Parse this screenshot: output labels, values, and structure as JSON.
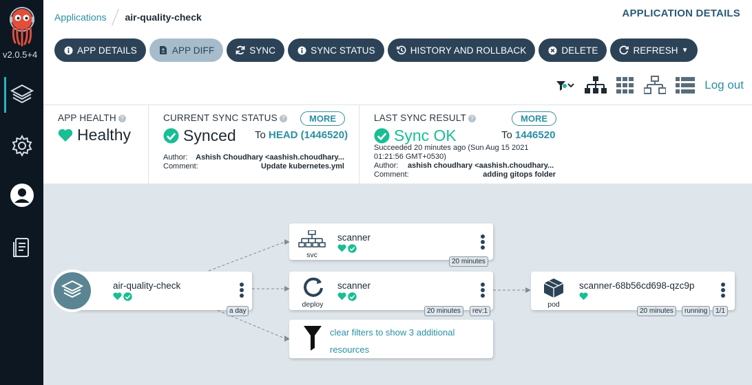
{
  "sidebar": {
    "version": "v2.0.5+4"
  },
  "header": {
    "breadcrumb_parent": "Applications",
    "breadcrumb_current": "air-quality-check",
    "page_title": "APPLICATION DETAILS"
  },
  "toolbar": {
    "buttons": [
      {
        "label": "APP DETAILS",
        "icon": "info-icon"
      },
      {
        "label": "APP DIFF",
        "icon": "file-diff-icon"
      },
      {
        "label": "SYNC",
        "icon": "sync-icon"
      },
      {
        "label": "SYNC STATUS",
        "icon": "info-icon"
      },
      {
        "label": "HISTORY AND ROLLBACK",
        "icon": "history-icon"
      },
      {
        "label": "DELETE",
        "icon": "times-circle-icon"
      },
      {
        "label": "REFRESH",
        "icon": "redo-icon"
      }
    ],
    "logout": "Log out"
  },
  "status": {
    "app_health": {
      "title": "APP HEALTH",
      "value": "Healthy"
    },
    "sync_status": {
      "title": "CURRENT SYNC STATUS",
      "more": "MORE",
      "value": "Synced",
      "to_prefix": "To",
      "to_value": "HEAD (1446520)",
      "author_label": "Author:",
      "author_value": "Ashish Choudhary <aashish.choudhary...",
      "comment_label": "Comment:",
      "comment_value": "Update kubernetes.yml"
    },
    "last_sync": {
      "title": "LAST SYNC RESULT",
      "more": "MORE",
      "value": "Sync OK",
      "to_prefix": "To",
      "to_value": "1446520",
      "succeeded_line1": "Succeeded 20 minutes ago (Sun Aug 15 2021",
      "succeeded_line2": "01:21:56 GMT+0530)",
      "author_label": "Author:",
      "author_value": "ashish choudhary <aashish.choudhary...",
      "comment_label": "Comment:",
      "comment_value": "adding gitops folder"
    }
  },
  "tree": {
    "app": {
      "name": "air-quality-check",
      "age": "a day"
    },
    "svc": {
      "name": "scanner",
      "kind": "svc",
      "age": "20 minutes"
    },
    "deploy": {
      "name": "scanner",
      "kind": "deploy",
      "age": "20 minutes",
      "rev": "rev:1"
    },
    "filter": {
      "line1": "clear filters to show 3 additional",
      "line2": "resources"
    },
    "pod": {
      "name": "scanner-68b56cd698-qzc9p",
      "kind": "pod",
      "age": "20 minutes",
      "state": "running",
      "ready": "1/1"
    }
  },
  "colors": {
    "healthy": "#18be94",
    "synced": "#18be94",
    "brand_dark": "#2c4357",
    "link": "#2b8fa3"
  }
}
